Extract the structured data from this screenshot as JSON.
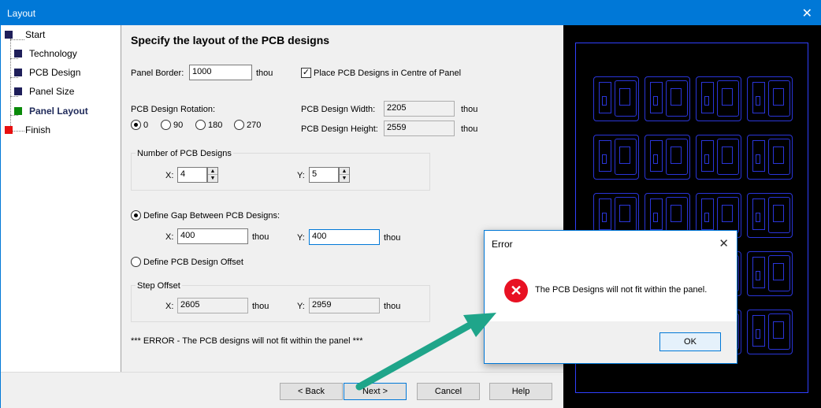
{
  "window": {
    "title": "Layout",
    "close_glyph": "✕"
  },
  "nav": {
    "items": [
      {
        "label": "Start",
        "color": "#1f1f5a"
      },
      {
        "label": "Technology",
        "color": "#1f1f5a"
      },
      {
        "label": "PCB Design",
        "color": "#1f1f5a"
      },
      {
        "label": "Panel Size",
        "color": "#1f1f5a"
      },
      {
        "label": "Panel Layout",
        "color": "#0a8a0a",
        "active": true
      },
      {
        "label": "Finish",
        "color": "#e81010"
      }
    ]
  },
  "form": {
    "heading": "Specify the layout of the PCB designs",
    "panel_border_label": "Panel Border:",
    "panel_border_value": "1000",
    "panel_border_unit": "thou",
    "centre_check_label": "Place PCB Designs in Centre of Panel",
    "centre_checked": true,
    "rotation_label": "PCB Design Rotation:",
    "rotations": [
      "0",
      "90",
      "180",
      "270"
    ],
    "rotation_selected": "0",
    "width_label": "PCB Design Width:",
    "width_value": "2205",
    "width_unit": "thou",
    "height_label": "PCB Design Height:",
    "height_value": "2559",
    "height_unit": "thou",
    "count_group_label": "Number of PCB Designs",
    "count_x_label": "X:",
    "count_x_value": "4",
    "count_y_label": "Y:",
    "count_y_value": "5",
    "gap_radio_label": "Define Gap Between PCB Designs:",
    "gap_x_label": "X:",
    "gap_x_value": "400",
    "gap_x_unit": "thou",
    "gap_y_label": "Y:",
    "gap_y_value": "400",
    "gap_y_unit": "thou",
    "offset_radio_label": "Define PCB Design Offset",
    "step_group_label": "Step Offset",
    "step_x_label": "X:",
    "step_x_value": "2605",
    "step_x_unit": "thou",
    "step_y_label": "Y:",
    "step_y_value": "2959",
    "step_y_unit": "thou",
    "error_text": "*** ERROR - The PCB designs will not fit within the panel ***"
  },
  "buttons": {
    "back": "< Back",
    "next": "Next >",
    "cancel": "Cancel",
    "help": "Help"
  },
  "error_dialog": {
    "title": "Error",
    "close_glyph": "✕",
    "icon_glyph": "✕",
    "message": "The PCB Designs will not fit within the panel.",
    "ok": "OK"
  },
  "colors": {
    "accent": "#0078d7",
    "error": "#e81123",
    "arrow": "#1fa58a",
    "pcb_outline": "#2a35d8"
  }
}
